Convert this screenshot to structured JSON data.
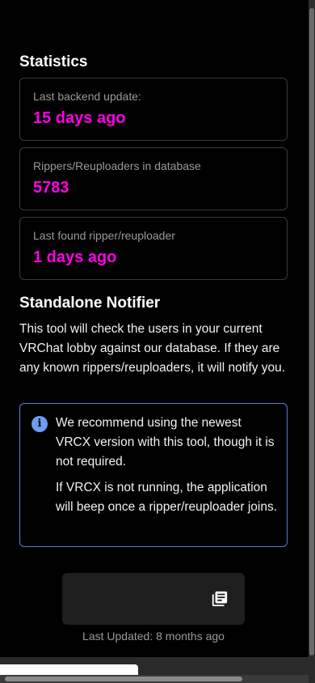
{
  "statistics": {
    "title": "Statistics",
    "cards": [
      {
        "label": "Last backend update:",
        "value": "15 days ago"
      },
      {
        "label": "Rippers/Reuploaders in database",
        "value": "5783"
      },
      {
        "label": "Last found ripper/reuploader",
        "value": "1 days ago"
      }
    ]
  },
  "notifier": {
    "title": "Standalone Notifier",
    "description": "This tool will check the users in your current VRChat lobby against our database. If they are any known rippers/reuploaders, it will notify you.",
    "info_icon": "info-icon",
    "info_paragraphs": [
      "We recommend using the newest VRCX version with this tool, though it is not required.",
      "If VRCX is not running, the application will beep once a ripper/reuploader joins."
    ]
  },
  "download": {
    "icon": "library-books-icon",
    "last_updated": "Last Updated: 8 months ago"
  },
  "colors": {
    "accent": "#ff00e6",
    "info_border": "#5e7bd6",
    "info_icon": "#6d9cf0"
  }
}
